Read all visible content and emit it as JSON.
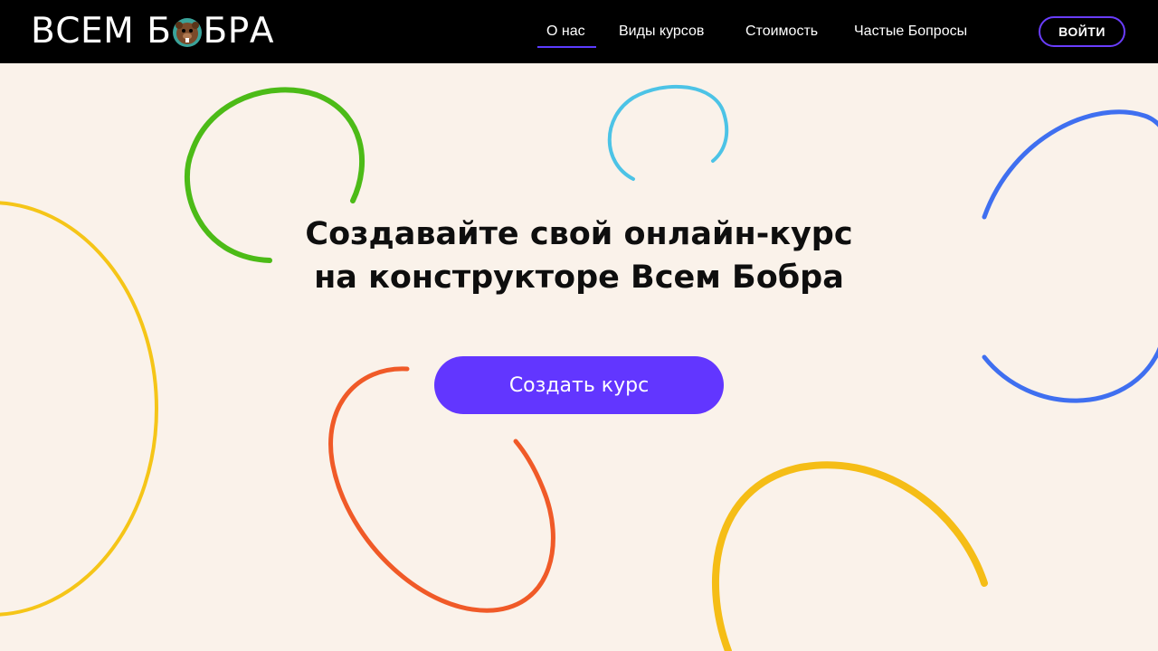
{
  "header": {
    "logo": {
      "word1": "ВСЕМ",
      "letter": "Б",
      "rest": "БРА"
    },
    "nav": [
      {
        "label": "О нас",
        "active": true
      },
      {
        "label": "Виды курсов",
        "active": false
      },
      {
        "label": "Стоимость",
        "active": false
      },
      {
        "label": "Частые Бопросы",
        "active": false
      }
    ],
    "login_label": "ВОЙТИ"
  },
  "hero": {
    "title_line1": "Создавайте свой онлайн-курс",
    "title_line2": "на конструкторе Всем Бобра",
    "cta_label": "Создать курс"
  },
  "colors": {
    "header_bg": "#000000",
    "page_bg": "#faf2ea",
    "accent": "#6236ff",
    "arc_green": "#4cbb17",
    "arc_cyan": "#4cc3e6",
    "arc_blue": "#3f6ff0",
    "arc_yellow": "#f5c518",
    "arc_orange": "#f05a28"
  },
  "icons": {
    "logo_mark": "beaver-icon"
  }
}
